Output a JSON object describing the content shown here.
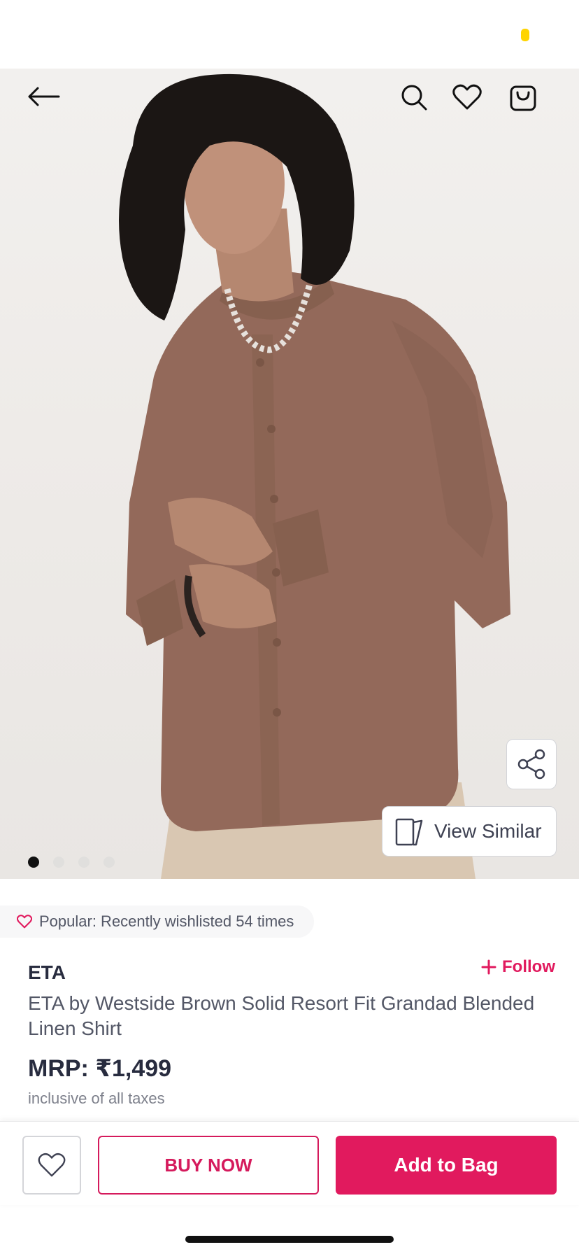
{
  "colors": {
    "accent": "#e11a5e",
    "status_dot": "#ffd400",
    "shirt": "#93695a",
    "pants": "#d9c7b2"
  },
  "header": {
    "back_icon": "arrow-left-icon",
    "search_icon": "search-icon",
    "wishlist_icon": "heart-icon",
    "bag_icon": "shopping-bag-icon"
  },
  "gallery": {
    "image_count": 4,
    "active_index": 0,
    "share_icon": "share-icon",
    "view_similar_label": "View Similar",
    "view_similar_icon": "cards-icon"
  },
  "product": {
    "popular_text": "Popular: Recently wishlisted 54 times",
    "brand": "ETA",
    "follow_label": "Follow",
    "name": "ETA by Westside Brown Solid Resort Fit Grandad Blended Linen Shirt",
    "mrp": "MRP: ₹1,499",
    "tax_note": "inclusive of all taxes"
  },
  "actions": {
    "wishlist_icon": "heart-outline-icon",
    "buy_now_label": "BUY NOW",
    "add_to_bag_label": "Add to Bag"
  }
}
